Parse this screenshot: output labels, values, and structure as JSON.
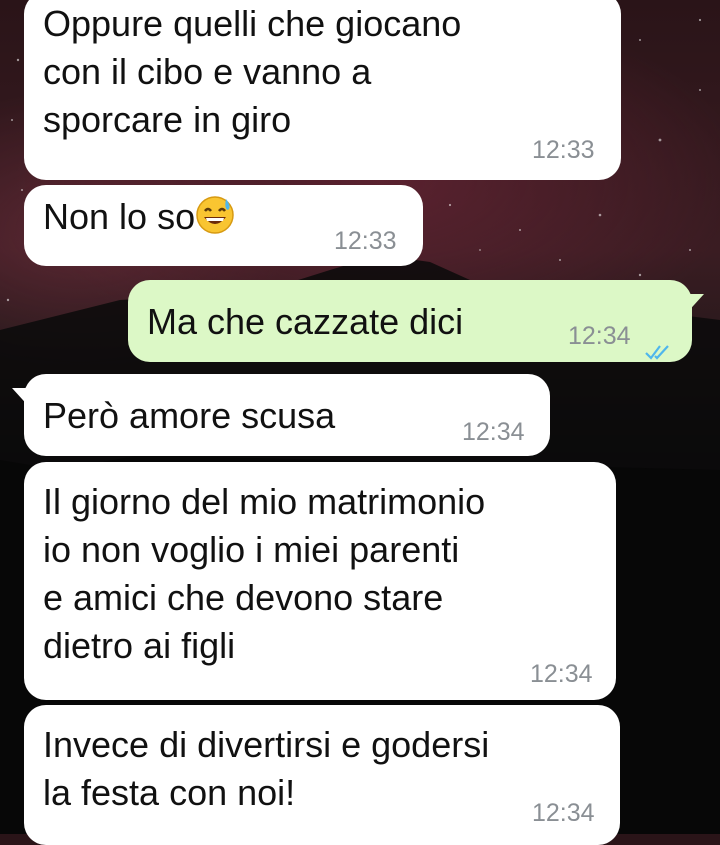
{
  "messages": [
    {
      "direction": "incoming",
      "text": "Oppure quelli che giocano\ncon il cibo e vanno a\nsporcare in giro",
      "time": "12:33"
    },
    {
      "direction": "incoming",
      "text": "Non lo so",
      "emoji": "sweat-smile-emoji",
      "time": "12:33"
    },
    {
      "direction": "outgoing",
      "text": "Ma che cazzate dici",
      "time": "12:34",
      "status": "read-double-check"
    },
    {
      "direction": "incoming",
      "text": "Però amore scusa",
      "time": "12:34"
    },
    {
      "direction": "incoming",
      "text": "Il giorno del mio matrimonio\nio non voglio i miei parenti\ne amici che devono stare\ndietro ai figli",
      "time": "12:34"
    },
    {
      "direction": "incoming",
      "text": "Invece di divertirsi e godersi\nla festa con noi!",
      "time": "12:34"
    }
  ],
  "colors": {
    "incoming_bubble": "#ffffff",
    "outgoing_bubble": "#dcf8c6",
    "timestamp": "#8a8f94",
    "read_ticks": "#4fb6ec"
  }
}
